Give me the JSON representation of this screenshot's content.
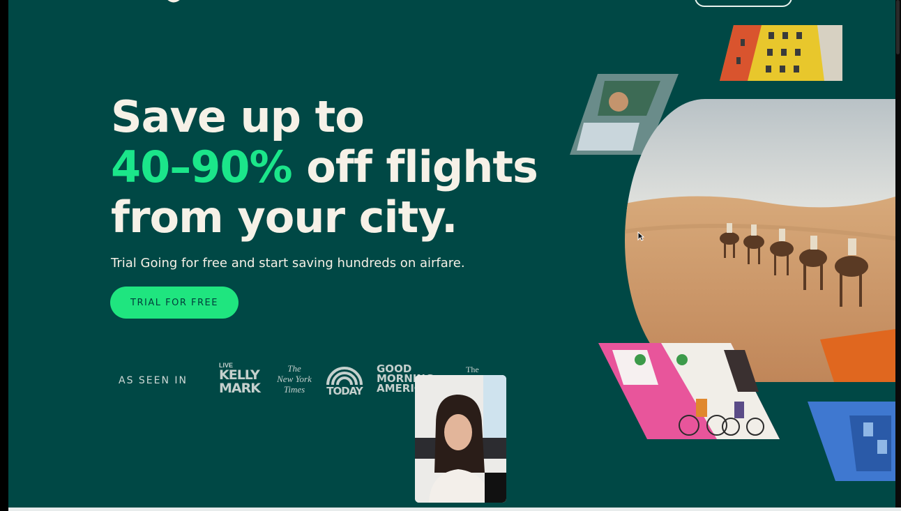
{
  "hero": {
    "headline_line1": "Save up to",
    "headline_accent": "40–90%",
    "headline_line2_rest": " off flights",
    "headline_line3": "from your city.",
    "subhead": "Trial Going for free and start saving hundreds on airfare.",
    "cta_label": "TRIAL FOR FREE"
  },
  "press": {
    "label": "AS SEEN IN",
    "logos": [
      {
        "name": "Live Kelly and Mark",
        "line1": "LIVE",
        "line2": "KELLY",
        "line3": "MARK"
      },
      {
        "name": "The New York Times",
        "line1": "The",
        "line2": "New York",
        "line3": "Times"
      },
      {
        "name": "Today",
        "word": "TODAY"
      },
      {
        "name": "Good Morning America",
        "line1": "GOOD",
        "line2": "MORNING",
        "line3": "AMERICA"
      },
      {
        "name": "The",
        "text": "The"
      }
    ]
  },
  "colors": {
    "background": "#004845",
    "accent": "#1be68a",
    "cta": "#1fe57f",
    "text": "#f6f1e7"
  },
  "icons": {
    "cursor": "pointer-cursor-icon"
  }
}
